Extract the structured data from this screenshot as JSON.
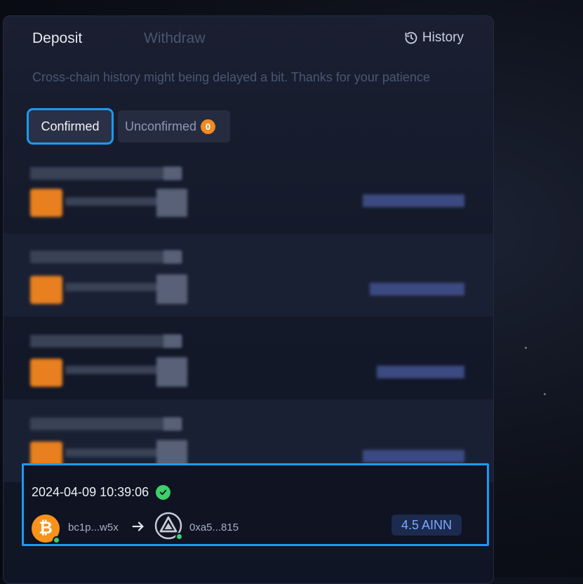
{
  "tabs": {
    "deposit": "Deposit",
    "withdraw": "Withdraw"
  },
  "history_label": "History",
  "notice": "Cross-chain history might being delayed a bit. Thanks for your patience",
  "filters": {
    "confirmed": "Confirmed",
    "unconfirmed": "Unconfirmed",
    "unconfirmed_count": "0"
  },
  "transaction": {
    "timestamp": "2024-04-09 10:39:06",
    "from_address": "bc1p...w5x",
    "to_address": "0xa5...815",
    "amount": "4.5 AINN"
  },
  "colors": {
    "accent": "#1a9bf5",
    "success": "#3fcf6b",
    "btc": "#f7931a",
    "badge": "#f08a24"
  },
  "icons": [
    "history-icon",
    "check-circle-icon",
    "bitcoin-icon",
    "arrow-right-icon",
    "ainn-token-icon"
  ]
}
